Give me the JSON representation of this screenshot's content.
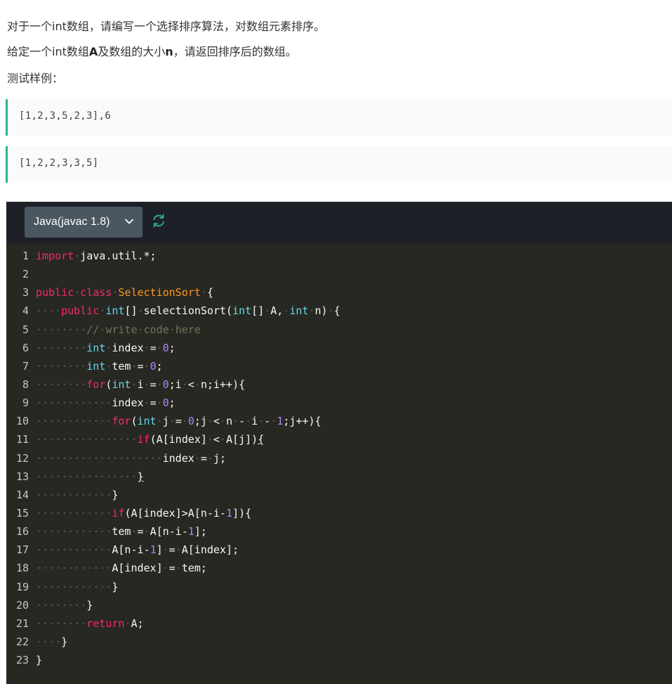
{
  "problem": {
    "line1_pre": "对于一个int数组，请编写一个选择排序算法，对数组元素排序。",
    "line2_a": "给定一个int数组",
    "line2_b": "A",
    "line2_c": "及数组的大小",
    "line2_d": "n",
    "line2_e": "，请返回排序后的数组。",
    "line3": "测试样例："
  },
  "samples": {
    "input": "[1,2,3,5,2,3],6",
    "output": "[1,2,2,3,3,5]"
  },
  "editor": {
    "language_label": "Java(javac 1.8)",
    "language_icon": "chevron-down-icon",
    "refresh_icon": "refresh-icon",
    "accent_color": "#2bb095",
    "background_color": "#272822",
    "code_lines": [
      "import java.util.*;",
      "",
      "public class SelectionSort {",
      "    public int[] selectionSort(int[] A, int n) {",
      "        // write code here",
      "        int index = 0;",
      "        int tem = 0;",
      "        for(int i = 0;i < n;i++){",
      "            index = 0;",
      "            for(int j = 0;j < n - i - 1;j++){",
      "                if(A[index] < A[j]){",
      "                    index = j;",
      "                }",
      "            }",
      "            if(A[index]>A[n-i-1]){",
      "            tem = A[n-i-1];",
      "            A[n-i-1] = A[index];",
      "            A[index] = tem;",
      "            }",
      "        }",
      "        return A;",
      "    }",
      "}"
    ]
  }
}
